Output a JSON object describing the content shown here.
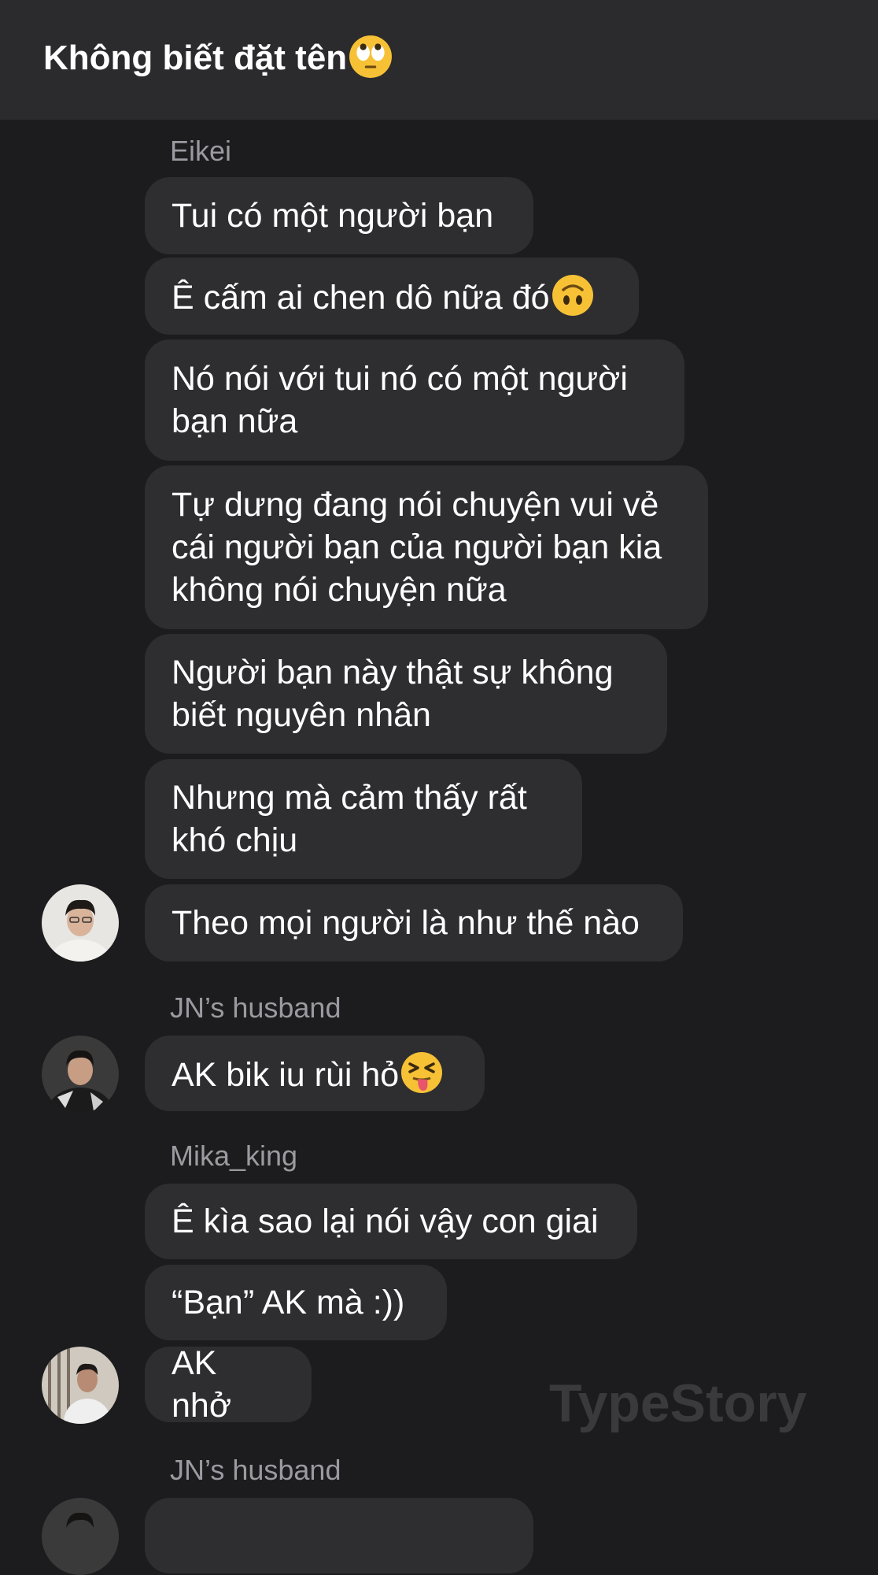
{
  "header": {
    "title": "Không biết đặt tên"
  },
  "messages": [
    {
      "sender": "Eikei"
    },
    {
      "text": "Tui có một người bạn"
    },
    {
      "text": "Ê cấm ai chen dô nữa đó"
    },
    {
      "text": "Nó nói với tui nó có một người\nbạn nữa"
    },
    {
      "text": "Tự dưng đang nói chuyện vui vẻ\ncái người bạn của người bạn kia\nkhông nói chuyện nữa"
    },
    {
      "text": "Người bạn này thật sự không\nbiết nguyên nhân"
    },
    {
      "text": "Nhưng mà cảm thấy rất\nkhó chịu"
    },
    {
      "text": "Theo mọi người là như thế nào"
    },
    {
      "sender": "JN’s husband"
    },
    {
      "text": "AK bik iu rùi hỏ"
    },
    {
      "sender": "Mika_king"
    },
    {
      "text": "Ê kìa sao lại nói vậy con giai"
    },
    {
      "text": "“Bạn” AK mà :))"
    },
    {
      "text": "AK nhở"
    },
    {
      "sender": "JN’s husband"
    }
  ],
  "watermark": "TypeStory",
  "emoji": {
    "title": "face-with-rolling-eyes-emoji",
    "msg2": "upside-down-face-emoji",
    "msg9": "squinting-face-with-tongue-emoji"
  },
  "colors": {
    "background": "#1c1c1e",
    "header": "#2b2b2d",
    "bubble": "#2e2e31",
    "sender": "#9a9aa0",
    "emoji_yellow": "#f7c136"
  }
}
